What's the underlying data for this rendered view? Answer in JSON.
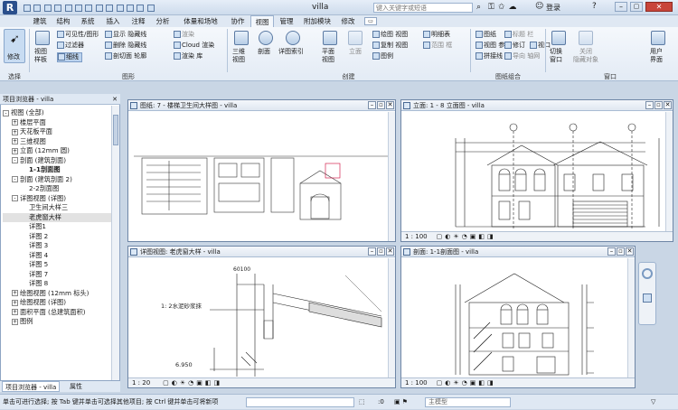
{
  "app": {
    "title": "villa",
    "search_placeholder": "键入关键字或短语",
    "user_label": "登录"
  },
  "tabs": [
    "建筑",
    "结构",
    "系统",
    "插入",
    "注释",
    "分析",
    "体量和场地",
    "协作",
    "视图",
    "管理",
    "附加模块",
    "修改"
  ],
  "active_tab": "视图",
  "ribbon": {
    "select_group": {
      "modify": "修改",
      "label": "选择"
    },
    "graphics": {
      "view_template": "视图\n样板",
      "visibility": "可见性/图形",
      "filters": "过滤器",
      "thin_lines": "细线",
      "show_hidden": "显示 隐藏线",
      "remove_hidden": "删除 隐藏线",
      "cut_profile": "剖切面 轮廓",
      "render": "渲染",
      "cloud_render": "Cloud 渲染",
      "render_gallery": "渲染 库",
      "label": "图形"
    },
    "create": {
      "3d": "三维\n视图",
      "section": "剖面",
      "callout": "详图索引",
      "plan": "平面\n视图",
      "elevation": "立面",
      "drafting": "绘图 视图",
      "duplicate": "复制 视图",
      "legends": "图例",
      "schedules": "明细表",
      "scope_box": "范围 框",
      "label": "创建"
    },
    "sheet": {
      "sheet": "图纸",
      "title_block": "标题 栏",
      "revisions": "修订",
      "guide_grid": "导向 轴网",
      "matchline": "拼接线",
      "view_ref": "视图 参照",
      "viewports": "视口",
      "label": "图纸组合"
    },
    "windows": {
      "switch": "切换\n窗口",
      "close_hidden": "关闭\n隐藏对象",
      "user_interface": "用户\n界面",
      "label": "窗口"
    }
  },
  "browser": {
    "title": "项目浏览器 - villa",
    "items": [
      {
        "label": "视图 (全部)",
        "level": 0,
        "exp": "-"
      },
      {
        "label": "楼层平面",
        "level": 1,
        "exp": "+"
      },
      {
        "label": "天花板平面",
        "level": 1,
        "exp": "+"
      },
      {
        "label": "三维视图",
        "level": 1,
        "exp": "+"
      },
      {
        "label": "立面 (12mm 圆)",
        "level": 1,
        "exp": "+"
      },
      {
        "label": "剖面 (建筑剖面)",
        "level": 1,
        "exp": "-"
      },
      {
        "label": "1-1剖面图",
        "level": 2,
        "exp": "",
        "bold": true
      },
      {
        "label": "剖面 (建筑剖面 2)",
        "level": 1,
        "exp": "-"
      },
      {
        "label": "2-2剖面图",
        "level": 2,
        "exp": ""
      },
      {
        "label": "详图视图 (详图)",
        "level": 1,
        "exp": "-"
      },
      {
        "label": "卫生间大样三",
        "level": 2,
        "exp": ""
      },
      {
        "label": "老虎窗大样",
        "level": 2,
        "exp": "",
        "selected": true
      },
      {
        "label": "详图1",
        "level": 2,
        "exp": ""
      },
      {
        "label": "详图 2",
        "level": 2,
        "exp": ""
      },
      {
        "label": "详图 3",
        "level": 2,
        "exp": ""
      },
      {
        "label": "详图 4",
        "level": 2,
        "exp": ""
      },
      {
        "label": "详图 5",
        "level": 2,
        "exp": ""
      },
      {
        "label": "详图 7",
        "level": 2,
        "exp": ""
      },
      {
        "label": "详图 8",
        "level": 2,
        "exp": ""
      },
      {
        "label": "绘图视图 (12mm 标头)",
        "level": 1,
        "exp": "+"
      },
      {
        "label": "绘图视图 (详图)",
        "level": 1,
        "exp": "+"
      },
      {
        "label": "面积平面 (总建筑面积)",
        "level": 1,
        "exp": "+"
      },
      {
        "label": "图例",
        "level": 1,
        "exp": "+"
      }
    ],
    "tab_browser": "项目浏览器 - villa",
    "tab_properties": "属性"
  },
  "views": {
    "v1": {
      "title": "图纸: 7 - 楼梯卫生间大样图 - villa"
    },
    "v2": {
      "title": "立面: 1 - 8 立面图 - villa",
      "scale": "1 : 100"
    },
    "v3": {
      "title": "详图视图: 老虎窗大样 - villa",
      "scale": "1 : 20",
      "note": "1: 2水泥砂浆抹",
      "dim1": "60100",
      "elev": "6.950"
    },
    "v4": {
      "title": "剖面: 1-1剖面图 - villa",
      "scale": "1 : 100"
    }
  },
  "status": {
    "text": "单击可进行选择; 按 Tab 键并单击可选择其他项目; 按 Ctrl 键并单击可将新项",
    "coord": ":0",
    "model": "主模型"
  }
}
